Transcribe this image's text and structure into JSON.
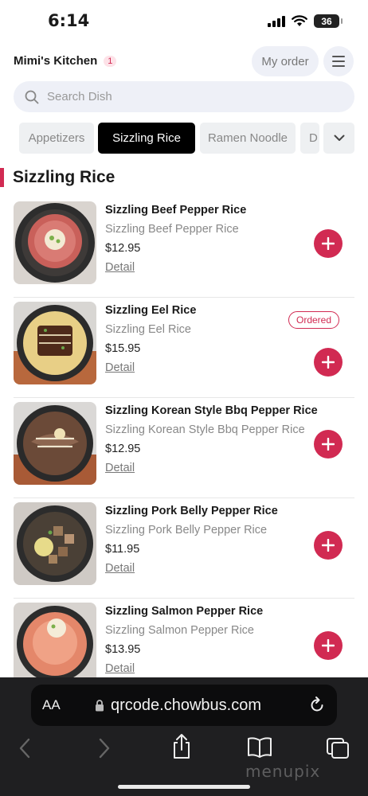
{
  "status": {
    "time": "6:14",
    "battery": "36"
  },
  "header": {
    "restaurant": "Mimi's Kitchen",
    "badge_count": "1",
    "my_order": "My order"
  },
  "search": {
    "placeholder": "Search Dish"
  },
  "tabs": [
    {
      "label": "Appetizers"
    },
    {
      "label": "Sizzling Rice"
    },
    {
      "label": "Ramen Noodle"
    },
    {
      "label": "D"
    }
  ],
  "section": {
    "title": "Sizzling Rice"
  },
  "items": [
    {
      "name": "Sizzling Beef Pepper Rice",
      "desc": "Sizzling Beef Pepper Rice",
      "price": "$12.95",
      "detail": "Detail"
    },
    {
      "name": "Sizzling Eel Rice",
      "desc": "Sizzling Eel Rice",
      "price": "$15.95",
      "detail": "Detail",
      "status": "Ordered"
    },
    {
      "name": "Sizzling Korean Style Bbq Pepper Rice",
      "desc": "Sizzling Korean Style Bbq Pepper Rice",
      "price": "$12.95",
      "detail": "Detail"
    },
    {
      "name": "Sizzling Pork Belly Pepper Rice",
      "desc": "Sizzling Pork Belly Pepper Rice",
      "price": "$11.95",
      "detail": "Detail"
    },
    {
      "name": "Sizzling Salmon Pepper Rice",
      "desc": "Sizzling Salmon Pepper Rice",
      "price": "$13.95",
      "detail": "Detail"
    }
  ],
  "browser": {
    "text_size": "AA",
    "url": "qrcode.chowbus.com",
    "watermark": "menupix"
  },
  "colors": {
    "accent": "#d12a52",
    "active_tab": "#000000",
    "browser_bg": "#1f1f21"
  },
  "icons": [
    "search-icon",
    "hamburger-menu-icon",
    "chevron-down-icon",
    "plus-icon",
    "lock-icon",
    "reload-icon",
    "back-arrow-icon",
    "forward-arrow-icon",
    "share-icon",
    "bookmarks-icon",
    "tabs-icon"
  ]
}
